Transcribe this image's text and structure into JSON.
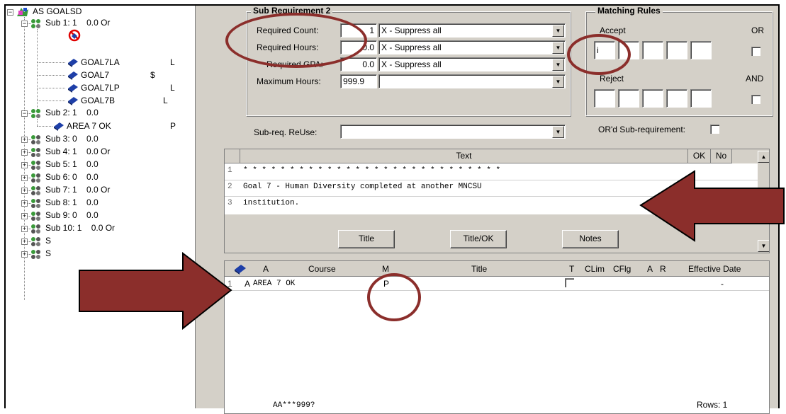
{
  "tree": {
    "root_label": "AS GOALSD",
    "sub1": {
      "label": "Sub 1:",
      "count": "1",
      "hours": "0.0 Or"
    },
    "sub1_children": [
      {
        "name": "GOAL7LA",
        "flag": "L"
      },
      {
        "name": "GOAL7",
        "flag": "$"
      },
      {
        "name": "GOAL7LP",
        "flag": "L"
      },
      {
        "name": "GOAL7B",
        "flag": "L"
      }
    ],
    "sub2": {
      "label": "Sub 2:",
      "count": "1",
      "hours": "0.0"
    },
    "sub2_child": {
      "name": "AREA 7 OK",
      "flag": "P"
    },
    "subs": [
      {
        "label": "Sub 3:",
        "count": "0",
        "hours": "0.0"
      },
      {
        "label": "Sub 4:",
        "count": "1",
        "hours": "0.0 Or"
      },
      {
        "label": "Sub 5:",
        "count": "1",
        "hours": "0.0"
      },
      {
        "label": "Sub 6:",
        "count": "0",
        "hours": "0.0"
      },
      {
        "label": "Sub 7:",
        "count": "1",
        "hours": "0.0 Or"
      },
      {
        "label": "Sub 8:",
        "count": "1",
        "hours": "0.0"
      },
      {
        "label": "Sub 9:",
        "count": "0",
        "hours": "0.0"
      },
      {
        "label": "Sub 10:",
        "count": "1",
        "hours": "0.0 Or"
      },
      {
        "label": "S",
        "count": "",
        "hours": ""
      },
      {
        "label": "S",
        "count": "",
        "hours": ""
      }
    ]
  },
  "subreq": {
    "title": "Sub Requirement 2",
    "required_count_label": "Required Count:",
    "required_count_value": "1",
    "required_count_option": "X - Suppress all",
    "required_hours_label": "Required Hours:",
    "required_hours_value": "0.0",
    "required_hours_option": "X - Suppress all",
    "required_gpa_label": "Required GPA:",
    "required_gpa_value": "0.0",
    "required_gpa_option": "X - Suppress all",
    "max_hours_label": "Maximum Hours:",
    "max_hours_value": "999.9",
    "max_hours_option": "",
    "reuse_label": "Sub-req. ReUse:",
    "reuse_value": "",
    "ord_label": "OR'd Sub-requirement:"
  },
  "matching": {
    "title": "Matching Rules",
    "accept_label": "Accept",
    "or_label": "OR",
    "reject_label": "Reject",
    "and_label": "AND",
    "accept_values": [
      "i",
      "",
      "",
      "",
      ""
    ]
  },
  "text_grid": {
    "header_text": "Text",
    "header_ok": "OK",
    "header_no": "No",
    "rows": [
      {
        "num": "1",
        "text": "* * * * * * * * * * * * * * * * * * * * * * * * * * * *"
      },
      {
        "num": "2",
        "text": "Goal 7 - Human Diversity completed at another MNCSU"
      },
      {
        "num": "3",
        "text": "institution."
      }
    ],
    "btn_title": "Title",
    "btn_title_ok": "Title/OK",
    "btn_notes": "Notes"
  },
  "course_grid": {
    "headers": {
      "a": "A",
      "course": "Course",
      "m": "M",
      "title": "Title",
      "t": "T",
      "clim": "CLim",
      "cflg": "CFlg",
      "a2": "A",
      "r": "R",
      "eff": "Effective Date"
    },
    "rows": [
      {
        "num": "1",
        "a": "A",
        "course": "AREA 7 OK",
        "m": "P",
        "title": "",
        "eff": "-"
      }
    ],
    "footer_code": "AA***999?",
    "rows_label": "Rows: 1"
  },
  "colors": {
    "highlight": "#8b2e2b",
    "panel": "#d4d0c8",
    "book_blue": "#1e3fa8"
  }
}
